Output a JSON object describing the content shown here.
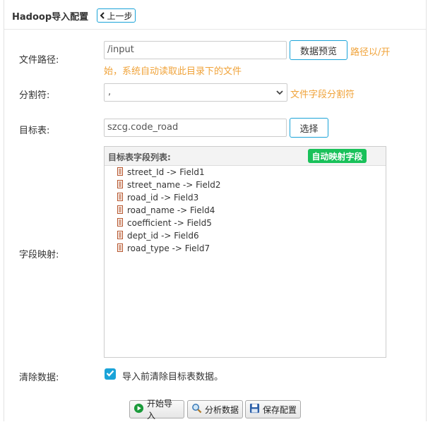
{
  "header": {
    "title": "Hadoop导入配置",
    "back_label": "上一步"
  },
  "form": {
    "file_path": {
      "label": "文件路径:",
      "value": "/input",
      "preview_button": "数据预览",
      "hint_line1": "路径以/开",
      "hint_line2": "始，系统自动读取此目录下的文件"
    },
    "delimiter": {
      "label": "分割符:",
      "value": ",",
      "hint": "文件字段分割符"
    },
    "target_table": {
      "label": "目标表:",
      "value": "szcg.code_road",
      "select_button": "选择"
    },
    "field_mapping": {
      "label": "字段映射:",
      "list_title": "目标表字段列表:",
      "auto_map_button": "自动映射字段",
      "fields": [
        "street_Id -> Field1",
        "street_name -> Field2",
        "road_id -> Field3",
        "road_name -> Field4",
        "coefficient -> Field5",
        "dept_id -> Field6",
        "road_type -> Field7"
      ]
    },
    "clear_data": {
      "label": "清除数据:",
      "checked": true,
      "checkbox_label": "导入前清除目标表数据。"
    }
  },
  "actions": {
    "start_import": "开始导入",
    "analyze_data": "分析数据",
    "save_config": "保存配置"
  },
  "colors": {
    "accent": "#1aa3d8",
    "hint": "#f0a33a",
    "success": "#19c15a"
  },
  "icons": {
    "back": "chevron-left-icon",
    "field": "document-icon",
    "start": "play-circle-icon",
    "analyze": "magnifier-icon",
    "save": "floppy-disk-icon"
  }
}
